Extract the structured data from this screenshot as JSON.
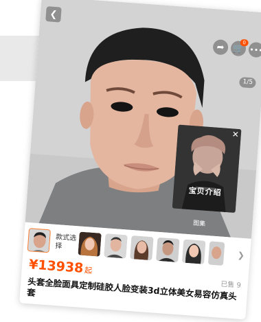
{
  "header": {
    "back_icon": "back-arrow-icon",
    "share_icon": "share-icon",
    "cart_icon": "cart-icon",
    "more_icon": "more-icon",
    "cart_badge": "0"
  },
  "gallery": {
    "counter": "1/5",
    "video_caption": "宝贝介绍",
    "gallery_label": "图集"
  },
  "variants": {
    "label": "款式选择",
    "thumb_count": 8
  },
  "product": {
    "price": "¥13938",
    "price_suffix": "起",
    "sold": "已售 9",
    "title": "头套全脸面具定制硅胶人脸变装3d立体美女易容仿真头套"
  },
  "colors": {
    "accent": "#ff5000"
  }
}
